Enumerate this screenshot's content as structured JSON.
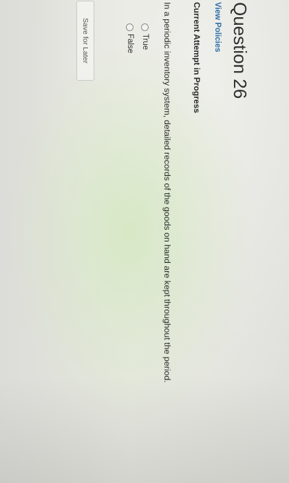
{
  "question": {
    "title": "Question 26",
    "view_policies_link": "View Policies",
    "attempt_status": "Current Attempt in Progress",
    "prompt": "In a periodic inventory system, detailed records of the goods on hand are kept throughout the period.",
    "options": [
      {
        "label": "True",
        "selected": false
      },
      {
        "label": "False",
        "selected": false
      }
    ],
    "save_button": "Save for Later"
  },
  "colors": {
    "link": "#2f6fa8",
    "text": "#2a2a2a"
  }
}
